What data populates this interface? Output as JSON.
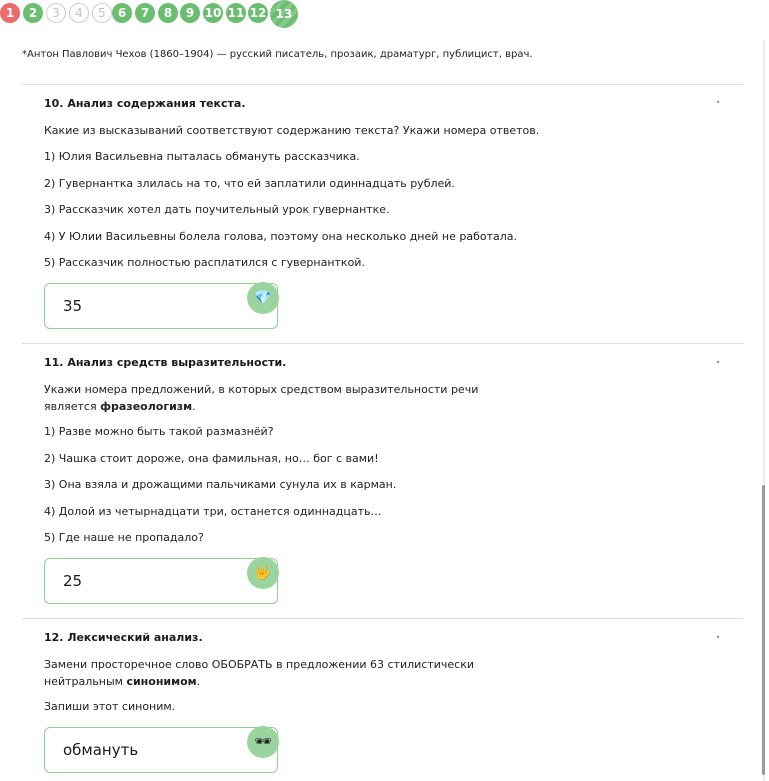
{
  "progress": {
    "steps": [
      {
        "label": "1",
        "state": "red"
      },
      {
        "label": "2",
        "state": "green"
      },
      {
        "label": "3",
        "state": "empty"
      },
      {
        "label": "4",
        "state": "empty"
      },
      {
        "label": "5",
        "state": "empty"
      },
      {
        "label": "6",
        "state": "green"
      },
      {
        "label": "7",
        "state": "green"
      },
      {
        "label": "8",
        "state": "green"
      },
      {
        "label": "9",
        "state": "green"
      },
      {
        "label": "10",
        "state": "green"
      },
      {
        "label": "11",
        "state": "green"
      },
      {
        "label": "12",
        "state": "green"
      },
      {
        "label": "13",
        "state": "current"
      }
    ]
  },
  "footnote": "*Антон Павлович Чехов (1860–1904) — русский писатель, прозаик, драматург, публицист, врач.",
  "q10": {
    "title": "10. Анализ содержания текста.",
    "prompt": "Какие из высказываний соответствуют содержанию текста? Укажи номера ответов.",
    "options": [
      "1) Юлия Васильевна пыталась обмануть рассказчика.",
      "2) Гувернантка злилась на то, что ей заплатили одиннадцать рублей.",
      "3) Рассказчик хотел дать поучительный урок гувернантке.",
      "4) У Юлии Васильевны болела голова, поэтому она несколько дней не работала.",
      "5) Рассказчик полностью расплатился с гувернанткой."
    ],
    "answer": "35",
    "badge_icon": "diamond-icon"
  },
  "q11": {
    "title": "11. Анализ средств выразительности.",
    "prompt_line1": "Укажи номера предложений, в которых средством выразительности речи",
    "prompt_line2_start": "является ",
    "prompt_line2_bold": "фразеологизм",
    "prompt_line2_end": ".",
    "options": [
      "1) Разве можно быть такой размазнёй?",
      "2) Чашка стоит дороже, она фамильная, но… бог с вами!",
      "3) Она взяла и дрожащими пальчиками сунула их в карман.",
      "4) Долой из четырнадцати три, останется одиннадцать…",
      "5) Где наше не пропадало?"
    ],
    "answer": "25",
    "badge_icon": "rock-hand-icon"
  },
  "q12": {
    "title": "12. Лексический анализ.",
    "prompt_line1": "Замени просторечное слово ОБОБРАТЬ в предложении 63 стилистически",
    "prompt_line2_start": "нейтральным ",
    "prompt_line2_bold": "синонимом",
    "prompt_line2_end": ".",
    "instruction": "Запиши этот синоним.",
    "answer": "обмануть",
    "badge_icon": "sunglasses-icon"
  },
  "glyphs": {
    "chevron": "˄",
    "diamond": "💎",
    "rock": "🤟",
    "sunglasses": "🕶"
  }
}
